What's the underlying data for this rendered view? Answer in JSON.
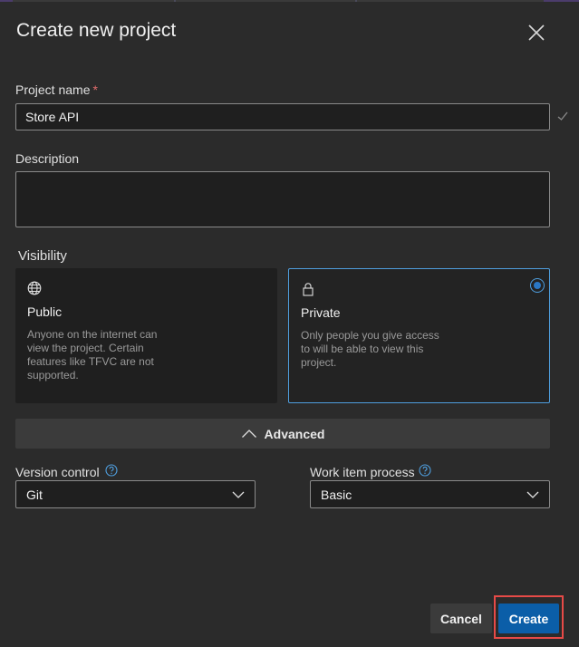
{
  "dialog": {
    "title": "Create new project"
  },
  "project_name": {
    "label": "Project name",
    "required_marker": "*",
    "value": "Store API"
  },
  "description": {
    "label": "Description",
    "value": ""
  },
  "visibility": {
    "label": "Visibility",
    "selected": "Private",
    "options": [
      {
        "icon": "globe-icon",
        "title": "Public",
        "description": "Anyone on the internet can view the project. Certain features like TFVC are not supported."
      },
      {
        "icon": "lock-icon",
        "title": "Private",
        "description": "Only people you give access to will be able to view this project."
      }
    ]
  },
  "advanced": {
    "label": "Advanced",
    "expanded": true
  },
  "version_control": {
    "label": "Version control",
    "value": "Git"
  },
  "work_item_process": {
    "label": "Work item process",
    "value": "Basic"
  },
  "buttons": {
    "cancel": "Cancel",
    "create": "Create"
  },
  "colors": {
    "accent": "#4f9fdf",
    "primary_button": "#0b5ea8",
    "highlight": "#e74a47",
    "background": "#2b2b2b"
  }
}
